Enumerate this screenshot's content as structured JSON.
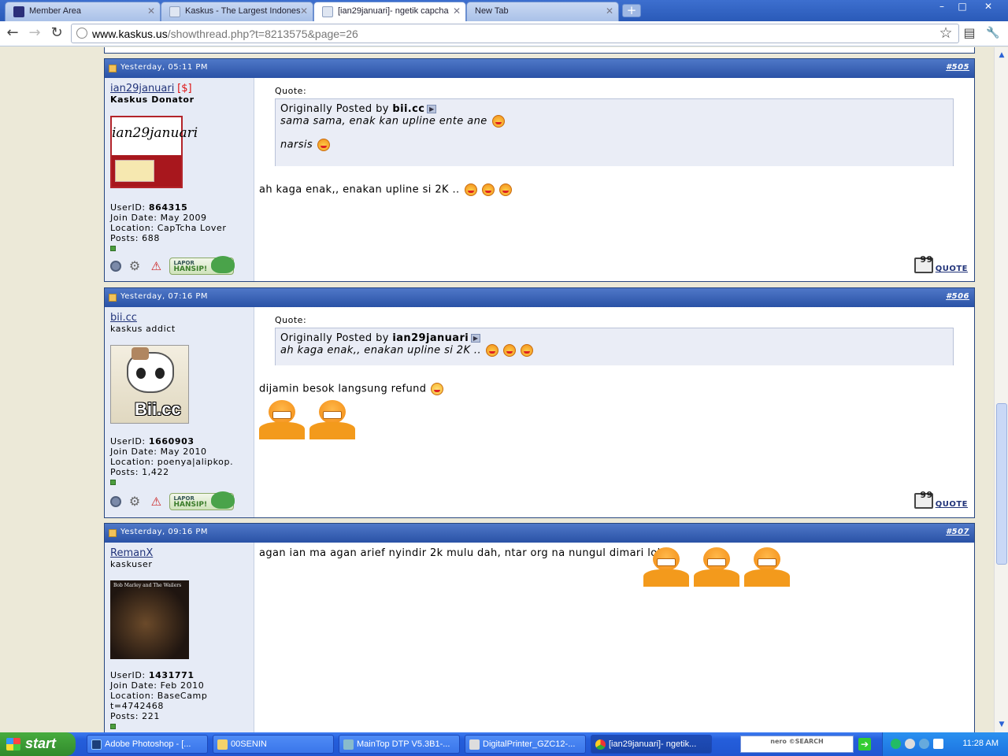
{
  "browser": {
    "tabs": [
      {
        "label": "Member Area",
        "icon": "kaskus-favicon",
        "active": false
      },
      {
        "label": "Kaskus - The Largest Indones",
        "icon": "page-favicon",
        "active": false
      },
      {
        "label": "[ian29januari]- ngetik capcha",
        "icon": "page-favicon",
        "active": true
      },
      {
        "label": "New Tab",
        "icon": "none",
        "active": false
      }
    ],
    "new_tab": "+",
    "window_controls": {
      "minimize": "–",
      "maximize": "□",
      "close": "✕"
    },
    "nav": {
      "back": "←",
      "forward": "→",
      "reload": "↻"
    },
    "url_host": "www.kaskus.us",
    "url_path": "/showthread.php?t=8213575&page=26",
    "icons": {
      "star": "☆",
      "page": "▤",
      "wrench": "🔧"
    }
  },
  "posts": [
    {
      "date": "Yesterday, 05:11 PM",
      "number": "#505",
      "username": "ian29januari",
      "donor_tag": "[$]",
      "user_title": "Kaskus Donator",
      "stats": {
        "userid_label": "UserID:",
        "userid": "864315",
        "join_label": "Join Date:",
        "join": "May 2009",
        "location_label": "Location:",
        "location": "CapTcha Lover",
        "posts_label": "Posts:",
        "posts": "688"
      },
      "quote_label": "Quote:",
      "quote_by_prefix": "Originally Posted by",
      "quote_author": "bii.cc",
      "quote_lines": [
        "sama sama, enak kan upline ente ane",
        "narsis"
      ],
      "message": "ah kaga enak,, enakan upline si 2K ..",
      "lapor": "LAPOR",
      "hansip": "HANSIP!",
      "quote_button": "QUOTE"
    },
    {
      "date": "Yesterday, 07:16 PM",
      "number": "#506",
      "username": "bii.cc",
      "user_title": "kaskus addict",
      "avatar_text": "Bii.cc",
      "stats": {
        "userid_label": "UserID:",
        "userid": "1660903",
        "join_label": "Join Date:",
        "join": "May 2010",
        "location_label": "Location:",
        "location": "poenya|alipkop.",
        "posts_label": "Posts:",
        "posts": "1,422"
      },
      "quote_label": "Quote:",
      "quote_by_prefix": "Originally Posted by",
      "quote_author": "ian29januari",
      "quote_lines": [
        "ah kaga enak,, enakan upline si 2K .."
      ],
      "message": "dijamin besok langsung refund",
      "lapor": "LAPOR",
      "hansip": "HANSIP!",
      "quote_button": "QUOTE"
    },
    {
      "date": "Yesterday, 09:16 PM",
      "number": "#507",
      "username": "RemanX",
      "user_title": "kaskuser",
      "avatar_text": "Bob Marley and The Wailers",
      "stats": {
        "userid_label": "UserID:",
        "userid": "1431771",
        "join_label": "Join Date:",
        "join": "Feb 2010",
        "location_label": "Location:",
        "location": "BaseCamp",
        "extra": "t=4742468",
        "posts_label": "Posts:",
        "posts": "221"
      },
      "message": "agan ian ma agan arief nyindir 2k mulu dah, ntar org na nungul dimari loh"
    }
  ],
  "taskbar": {
    "start": "start",
    "items": [
      {
        "label": "Adobe Photoshop - [...",
        "icon": "photoshop-icon"
      },
      {
        "label": "00SENIN",
        "icon": "folder-icon"
      },
      {
        "label": "MainTop DTP V5.3B1-...",
        "icon": "maintop-icon"
      },
      {
        "label": "DigitalPrinter_GZC12-...",
        "icon": "printer-icon"
      },
      {
        "label": "[ian29januari]- ngetik...",
        "icon": "chrome-icon"
      }
    ],
    "nero": "nero ©SEARCH",
    "clock": "11:28 AM"
  }
}
